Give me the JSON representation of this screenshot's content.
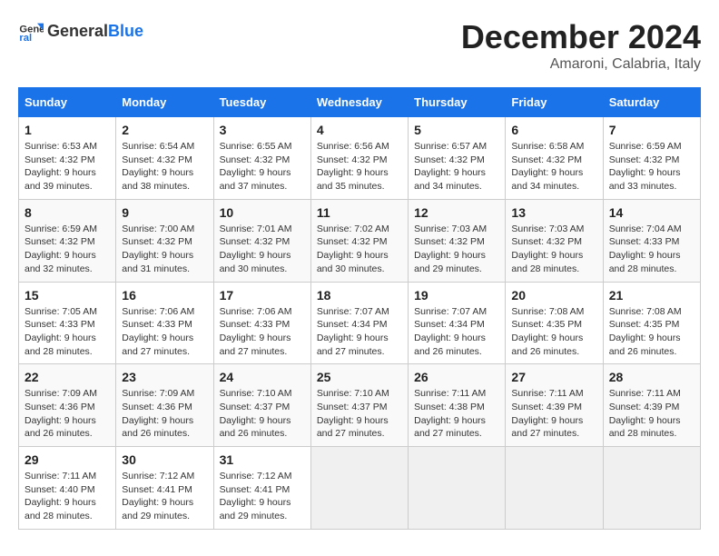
{
  "header": {
    "logo_general": "General",
    "logo_blue": "Blue",
    "title": "December 2024",
    "subtitle": "Amaroni, Calabria, Italy"
  },
  "calendar": {
    "days_of_week": [
      "Sunday",
      "Monday",
      "Tuesday",
      "Wednesday",
      "Thursday",
      "Friday",
      "Saturday"
    ],
    "weeks": [
      [
        {
          "day": "1",
          "sunrise": "6:53 AM",
          "sunset": "4:32 PM",
          "daylight": "9 hours and 39 minutes."
        },
        {
          "day": "2",
          "sunrise": "6:54 AM",
          "sunset": "4:32 PM",
          "daylight": "9 hours and 38 minutes."
        },
        {
          "day": "3",
          "sunrise": "6:55 AM",
          "sunset": "4:32 PM",
          "daylight": "9 hours and 37 minutes."
        },
        {
          "day": "4",
          "sunrise": "6:56 AM",
          "sunset": "4:32 PM",
          "daylight": "9 hours and 35 minutes."
        },
        {
          "day": "5",
          "sunrise": "6:57 AM",
          "sunset": "4:32 PM",
          "daylight": "9 hours and 34 minutes."
        },
        {
          "day": "6",
          "sunrise": "6:58 AM",
          "sunset": "4:32 PM",
          "daylight": "9 hours and 34 minutes."
        },
        {
          "day": "7",
          "sunrise": "6:59 AM",
          "sunset": "4:32 PM",
          "daylight": "9 hours and 33 minutes."
        }
      ],
      [
        {
          "day": "8",
          "sunrise": "6:59 AM",
          "sunset": "4:32 PM",
          "daylight": "9 hours and 32 minutes."
        },
        {
          "day": "9",
          "sunrise": "7:00 AM",
          "sunset": "4:32 PM",
          "daylight": "9 hours and 31 minutes."
        },
        {
          "day": "10",
          "sunrise": "7:01 AM",
          "sunset": "4:32 PM",
          "daylight": "9 hours and 30 minutes."
        },
        {
          "day": "11",
          "sunrise": "7:02 AM",
          "sunset": "4:32 PM",
          "daylight": "9 hours and 30 minutes."
        },
        {
          "day": "12",
          "sunrise": "7:03 AM",
          "sunset": "4:32 PM",
          "daylight": "9 hours and 29 minutes."
        },
        {
          "day": "13",
          "sunrise": "7:03 AM",
          "sunset": "4:32 PM",
          "daylight": "9 hours and 28 minutes."
        },
        {
          "day": "14",
          "sunrise": "7:04 AM",
          "sunset": "4:33 PM",
          "daylight": "9 hours and 28 minutes."
        }
      ],
      [
        {
          "day": "15",
          "sunrise": "7:05 AM",
          "sunset": "4:33 PM",
          "daylight": "9 hours and 28 minutes."
        },
        {
          "day": "16",
          "sunrise": "7:06 AM",
          "sunset": "4:33 PM",
          "daylight": "9 hours and 27 minutes."
        },
        {
          "day": "17",
          "sunrise": "7:06 AM",
          "sunset": "4:33 PM",
          "daylight": "9 hours and 27 minutes."
        },
        {
          "day": "18",
          "sunrise": "7:07 AM",
          "sunset": "4:34 PM",
          "daylight": "9 hours and 27 minutes."
        },
        {
          "day": "19",
          "sunrise": "7:07 AM",
          "sunset": "4:34 PM",
          "daylight": "9 hours and 26 minutes."
        },
        {
          "day": "20",
          "sunrise": "7:08 AM",
          "sunset": "4:35 PM",
          "daylight": "9 hours and 26 minutes."
        },
        {
          "day": "21",
          "sunrise": "7:08 AM",
          "sunset": "4:35 PM",
          "daylight": "9 hours and 26 minutes."
        }
      ],
      [
        {
          "day": "22",
          "sunrise": "7:09 AM",
          "sunset": "4:36 PM",
          "daylight": "9 hours and 26 minutes."
        },
        {
          "day": "23",
          "sunrise": "7:09 AM",
          "sunset": "4:36 PM",
          "daylight": "9 hours and 26 minutes."
        },
        {
          "day": "24",
          "sunrise": "7:10 AM",
          "sunset": "4:37 PM",
          "daylight": "9 hours and 26 minutes."
        },
        {
          "day": "25",
          "sunrise": "7:10 AM",
          "sunset": "4:37 PM",
          "daylight": "9 hours and 27 minutes."
        },
        {
          "day": "26",
          "sunrise": "7:11 AM",
          "sunset": "4:38 PM",
          "daylight": "9 hours and 27 minutes."
        },
        {
          "day": "27",
          "sunrise": "7:11 AM",
          "sunset": "4:39 PM",
          "daylight": "9 hours and 27 minutes."
        },
        {
          "day": "28",
          "sunrise": "7:11 AM",
          "sunset": "4:39 PM",
          "daylight": "9 hours and 28 minutes."
        }
      ],
      [
        {
          "day": "29",
          "sunrise": "7:11 AM",
          "sunset": "4:40 PM",
          "daylight": "9 hours and 28 minutes."
        },
        {
          "day": "30",
          "sunrise": "7:12 AM",
          "sunset": "4:41 PM",
          "daylight": "9 hours and 29 minutes."
        },
        {
          "day": "31",
          "sunrise": "7:12 AM",
          "sunset": "4:41 PM",
          "daylight": "9 hours and 29 minutes."
        },
        null,
        null,
        null,
        null
      ]
    ]
  },
  "labels": {
    "sunrise_label": "Sunrise:",
    "sunset_label": "Sunset:",
    "daylight_label": "Daylight:"
  }
}
